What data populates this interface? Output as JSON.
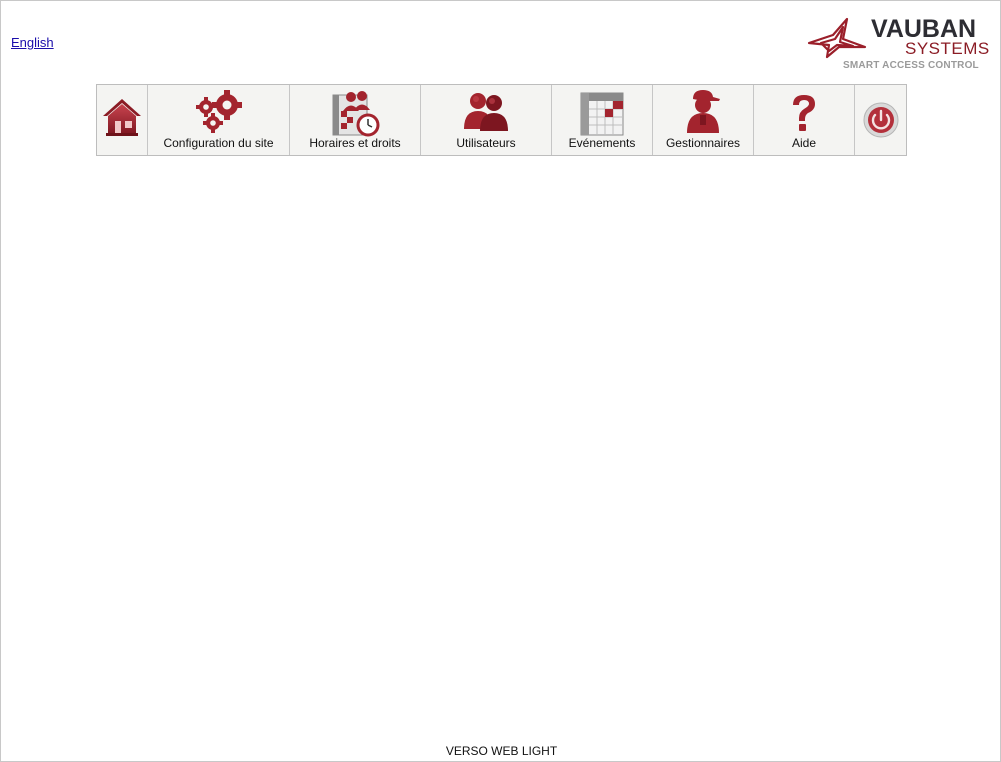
{
  "header": {
    "language_link": "English",
    "logo": {
      "brand": "VAUBAN",
      "brand_sub": "SYSTEMS",
      "tagline": "SMART ACCESS CONTROL",
      "icon": "vauban-star-icon"
    }
  },
  "menu": {
    "items": [
      {
        "id": "home",
        "label": "",
        "icon": "home-icon"
      },
      {
        "id": "site-config",
        "label": "Configuration du site",
        "icon": "gears-icon"
      },
      {
        "id": "schedules",
        "label": "Horaires et droits",
        "icon": "calendar-clock-icon"
      },
      {
        "id": "users",
        "label": "Utilisateurs",
        "icon": "users-icon"
      },
      {
        "id": "events",
        "label": "Evénements",
        "icon": "calendar-grid-icon"
      },
      {
        "id": "managers",
        "label": "Gestionnaires",
        "icon": "manager-icon"
      },
      {
        "id": "help",
        "label": "Aide",
        "icon": "question-mark-icon"
      },
      {
        "id": "logout",
        "label": "",
        "icon": "power-icon"
      }
    ]
  },
  "footer": {
    "text": "VERSO WEB LIGHT"
  },
  "colors": {
    "accent": "#9b1f2a",
    "menu_bg": "#f4f4f2",
    "border": "#bdbdbd"
  }
}
